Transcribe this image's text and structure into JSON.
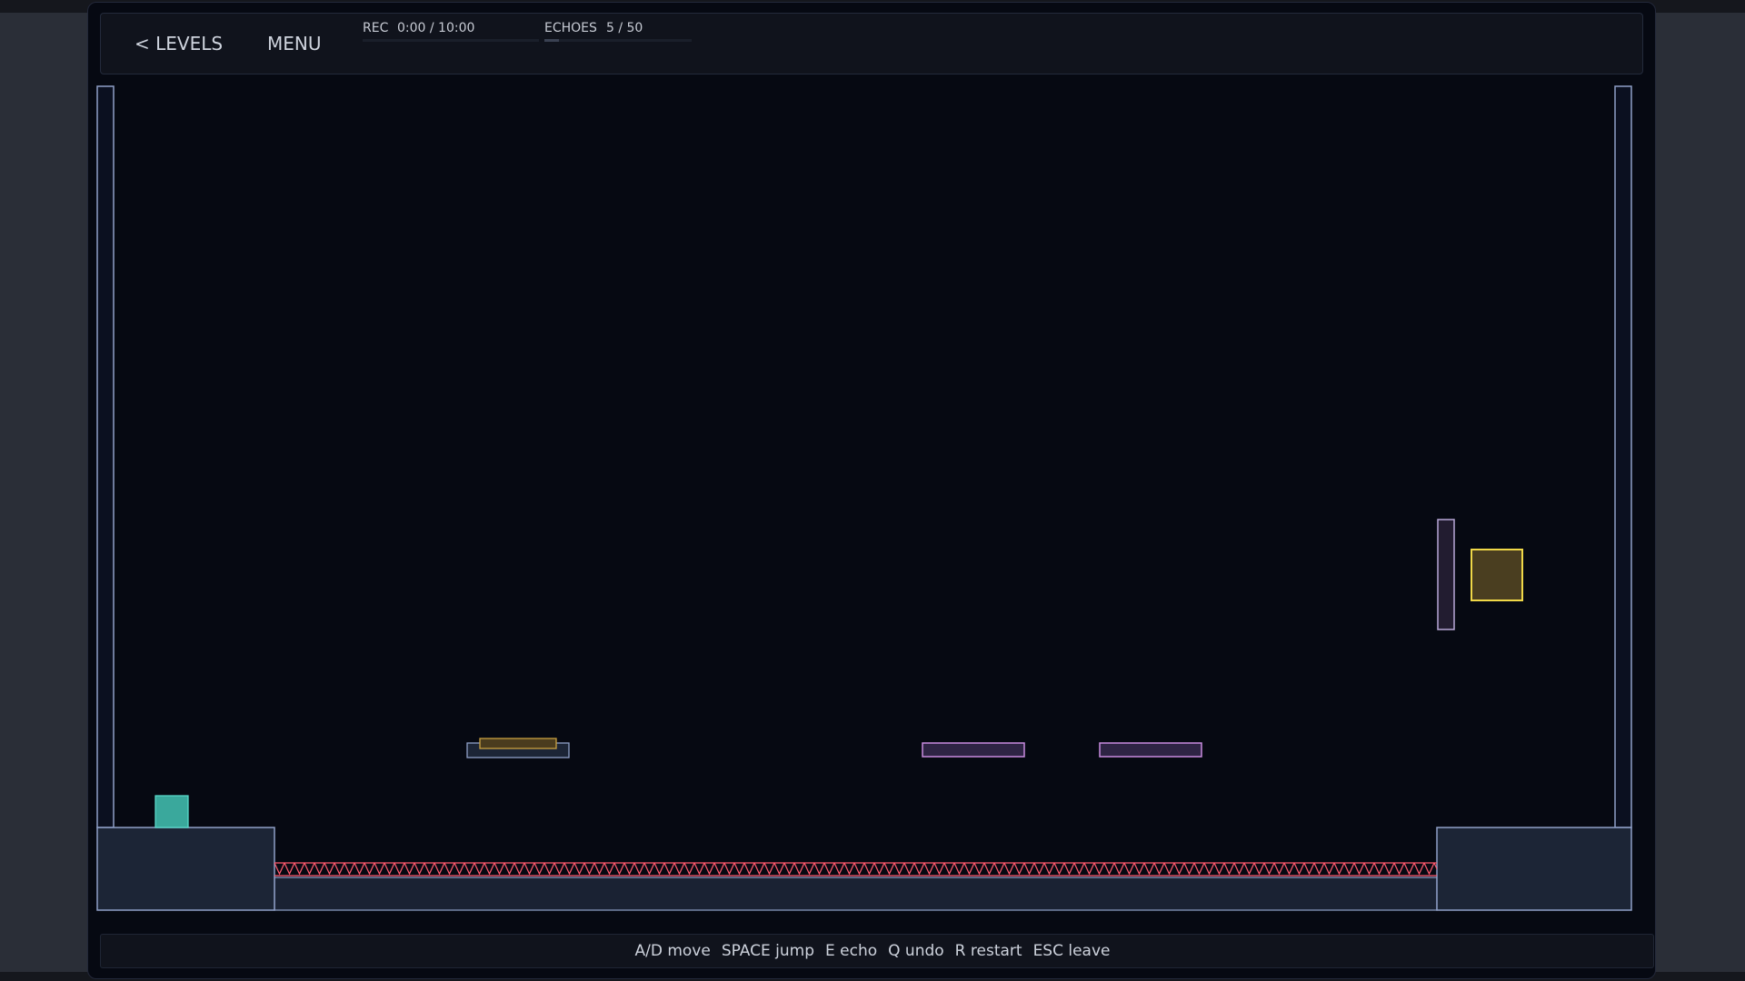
{
  "header": {
    "levels_label": "< LEVELS",
    "menu_label": "MENU",
    "rec_label": "REC",
    "rec_time": "0:00 / 10:00",
    "rec_progress": 0,
    "echoes_label": "ECHOES",
    "echoes_count": "5 / 50",
    "echoes_progress": 0.1
  },
  "controls": [
    "A/D move",
    "SPACE jump",
    "E echo",
    "Q undo",
    "R restart",
    "ESC leave"
  ],
  "colors": {
    "background": "#060912",
    "wall_stroke": "#8fa0c8",
    "wall_fill": "#1c2536",
    "spikes": "#ff5a6e",
    "player": "#3aa89c",
    "pressure_plate": "#c8a040",
    "toggle_platform": "#c88ce0",
    "goal": "#f0d848"
  },
  "entities": {
    "player": "teal block",
    "button": "pressure plate",
    "platforms": "violet toggle platforms",
    "door": "violet gate",
    "goal": "gold exit block",
    "hazard": "spike strip"
  }
}
